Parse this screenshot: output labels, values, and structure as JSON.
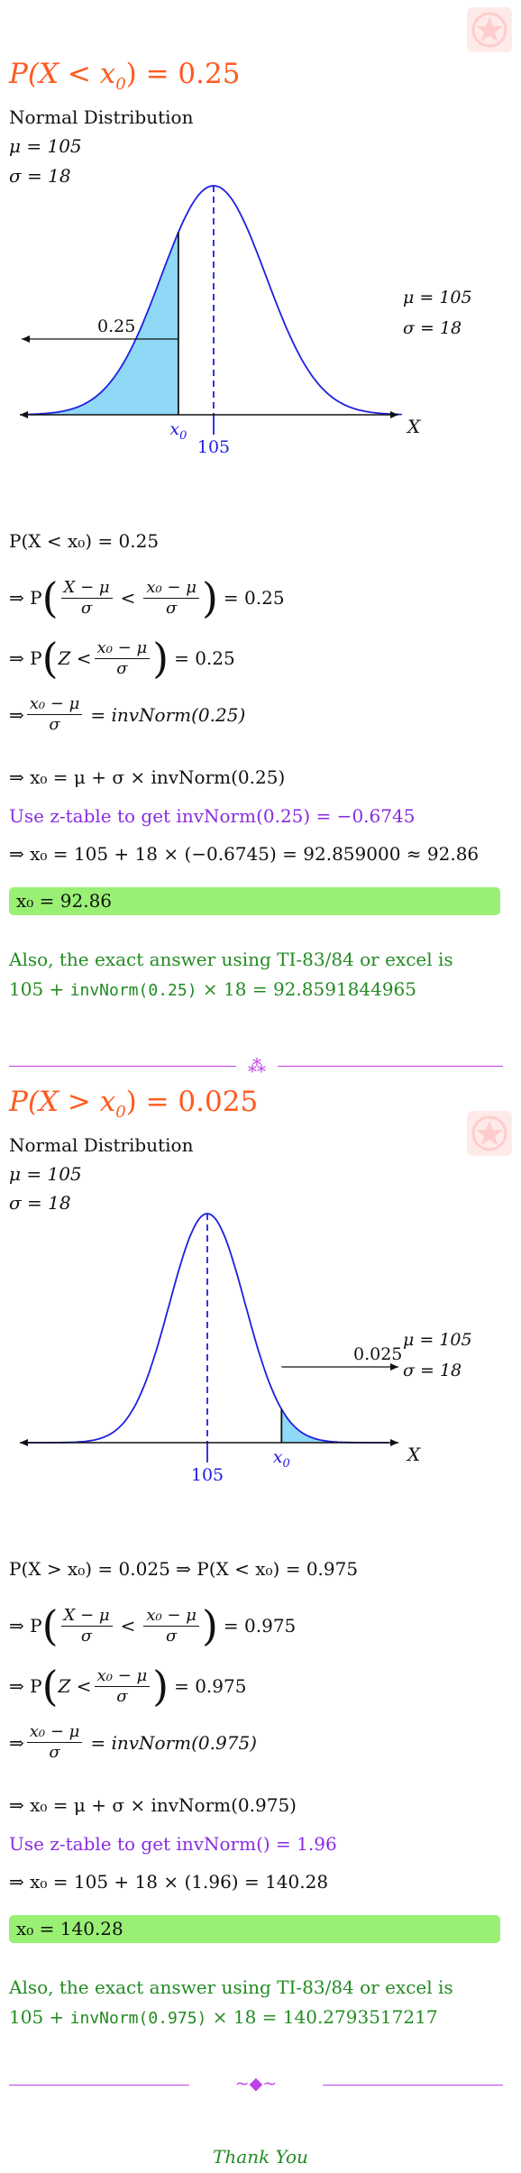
{
  "logo_color": "#ffdada",
  "problem1": {
    "title_lhs": "P(X < x",
    "title_sub": "0",
    "title_rhs": ") = 0.25",
    "dist_label": "Normal Distribution",
    "mu_line": "μ = 105",
    "sigma_line": "σ = 18",
    "graph": {
      "mean_label": "105",
      "x_label": "x",
      "x_sub": "0",
      "axis_label": "X",
      "area_label": "0.25",
      "legend_mu": "μ = 105",
      "legend_sigma": "σ = 18",
      "shade": "left"
    },
    "steps": {
      "s1": "P(X < x₀) = 0.25",
      "s2_pre": "⇒ P",
      "s2_num1": "X − μ",
      "s2_den1": "σ",
      "s2_lt": "<",
      "s2_num2": "x₀ − μ",
      "s2_den2": "σ",
      "s2_post": "= 0.25",
      "s3_pre": "⇒ P",
      "s3_z": "Z <",
      "s3_num": "x₀ − μ",
      "s3_den": "σ",
      "s3_post": "= 0.25",
      "s4_pre": "⇒",
      "s4_num": "x₀ − μ",
      "s4_den": "σ",
      "s4_post": "= invNorm(0.25)",
      "s5": "⇒ x₀ = μ + σ × invNorm(0.25)",
      "ztable": "Use z-table to get invNorm(0.25) = −0.6745",
      "s6": "⇒ x₀ = 105 + 18 × (−0.6745) = 92.859000 ≈ 92.86",
      "answer": "x₀ = 92.86",
      "also": "Also, the exact answer using TI-83/84 or excel is",
      "exact_pre": "105 +",
      "exact_fn": "invNorm(0.25)",
      "exact_post": "× 18 = 92.8591844965"
    }
  },
  "problem2": {
    "title_lhs": "P(X > x",
    "title_sub": "0",
    "title_rhs": ") = 0.025",
    "dist_label": "Normal Distribution",
    "mu_line": "μ = 105",
    "sigma_line": "σ = 18",
    "graph": {
      "mean_label": "105",
      "x_label": "x",
      "x_sub": "0",
      "axis_label": "X",
      "area_label": "0.025",
      "legend_mu": "μ = 105",
      "legend_sigma": "σ = 18",
      "shade": "right"
    },
    "steps": {
      "s1": "P(X > x₀) = 0.025 ⇒ P(X < x₀) = 0.975",
      "s2_pre": "⇒ P",
      "s2_num1": "X − μ",
      "s2_den1": "σ",
      "s2_lt": "<",
      "s2_num2": "x₀ − μ",
      "s2_den2": "σ",
      "s2_post": "= 0.975",
      "s3_pre": "⇒ P",
      "s3_z": "Z <",
      "s3_num": "x₀ − μ",
      "s3_den": "σ",
      "s3_post": "= 0.975",
      "s4_pre": "⇒",
      "s4_num": "x₀ − μ",
      "s4_den": "σ",
      "s4_post": "= invNorm(0.975)",
      "s5": "⇒ x₀ = μ + σ × invNorm(0.975)",
      "ztable": "Use z-table to get invNorm() = 1.96",
      "s6": "⇒ x₀ = 105 + 18 × (1.96) = 140.28",
      "answer": "x₀ = 140.28",
      "also": "Also, the exact answer using TI-83/84 or excel is",
      "exact_pre": "105 +",
      "exact_fn": "invNorm(0.975)",
      "exact_post": "× 18 = 140.2793517217"
    }
  },
  "divider1_glyph": "⁂",
  "divider2_glyph": "~◆~",
  "thanks": "Thank You"
}
